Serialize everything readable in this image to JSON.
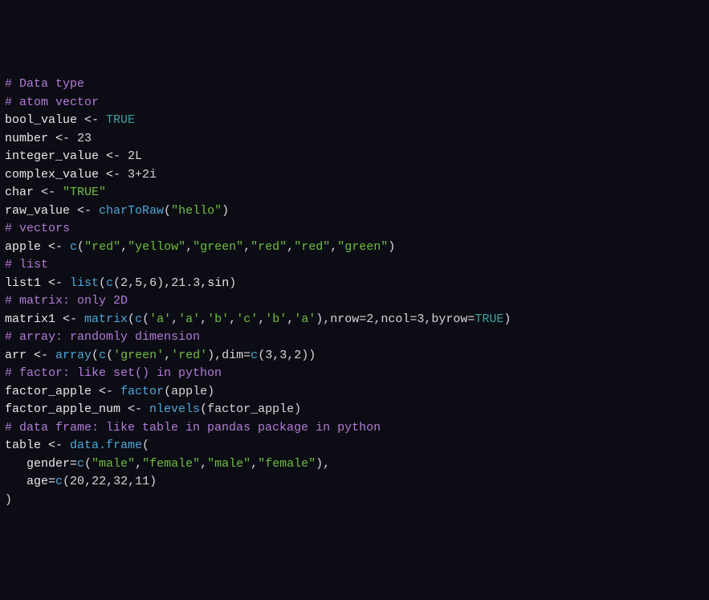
{
  "code": {
    "lines": [
      {
        "spans": [
          {
            "cls": "tok-comment",
            "t": "# Data type"
          }
        ]
      },
      {
        "spans": [
          {
            "cls": "tok-comment",
            "t": "# atom vector"
          }
        ]
      },
      {
        "spans": [
          {
            "cls": "tok-ident",
            "t": "bool_value "
          },
          {
            "cls": "tok-assign",
            "t": "<- "
          },
          {
            "cls": "tok-bool",
            "t": "TRUE"
          }
        ]
      },
      {
        "spans": [
          {
            "cls": "tok-ident",
            "t": "number "
          },
          {
            "cls": "tok-assign",
            "t": "<- "
          },
          {
            "cls": "tok-num",
            "t": "23"
          }
        ]
      },
      {
        "spans": [
          {
            "cls": "tok-ident",
            "t": "integer_value "
          },
          {
            "cls": "tok-assign",
            "t": "<- "
          },
          {
            "cls": "tok-num",
            "t": "2L"
          }
        ]
      },
      {
        "spans": [
          {
            "cls": "tok-ident",
            "t": "complex_value "
          },
          {
            "cls": "tok-assign",
            "t": "<- "
          },
          {
            "cls": "tok-num",
            "t": "3+2i"
          }
        ]
      },
      {
        "spans": [
          {
            "cls": "tok-ident",
            "t": "char "
          },
          {
            "cls": "tok-assign",
            "t": "<- "
          },
          {
            "cls": "tok-str",
            "t": "\"TRUE\""
          }
        ]
      },
      {
        "spans": [
          {
            "cls": "tok-ident",
            "t": "raw_value "
          },
          {
            "cls": "tok-assign",
            "t": "<- "
          },
          {
            "cls": "tok-func",
            "t": "charToRaw"
          },
          {
            "cls": "tok-punc",
            "t": "("
          },
          {
            "cls": "tok-str",
            "t": "\"hello\""
          },
          {
            "cls": "tok-punc",
            "t": ")"
          }
        ]
      },
      {
        "spans": [
          {
            "cls": "tok-comment",
            "t": "# vectors"
          }
        ]
      },
      {
        "spans": [
          {
            "cls": "tok-ident",
            "t": "apple "
          },
          {
            "cls": "tok-assign",
            "t": "<- "
          },
          {
            "cls": "tok-func",
            "t": "c"
          },
          {
            "cls": "tok-punc",
            "t": "("
          },
          {
            "cls": "tok-str",
            "t": "\"red\""
          },
          {
            "cls": "tok-punc",
            "t": ","
          },
          {
            "cls": "tok-str",
            "t": "\"yellow\""
          },
          {
            "cls": "tok-punc",
            "t": ","
          },
          {
            "cls": "tok-str",
            "t": "\"green\""
          },
          {
            "cls": "tok-punc",
            "t": ","
          },
          {
            "cls": "tok-str",
            "t": "\"red\""
          },
          {
            "cls": "tok-punc",
            "t": ","
          },
          {
            "cls": "tok-str",
            "t": "\"red\""
          },
          {
            "cls": "tok-punc",
            "t": ","
          },
          {
            "cls": "tok-str",
            "t": "\"green\""
          },
          {
            "cls": "tok-punc",
            "t": ")"
          }
        ]
      },
      {
        "spans": [
          {
            "cls": "tok-comment",
            "t": "# list"
          }
        ]
      },
      {
        "spans": [
          {
            "cls": "tok-ident",
            "t": "list1 "
          },
          {
            "cls": "tok-assign",
            "t": "<- "
          },
          {
            "cls": "tok-func",
            "t": "list"
          },
          {
            "cls": "tok-punc",
            "t": "("
          },
          {
            "cls": "tok-func",
            "t": "c"
          },
          {
            "cls": "tok-punc",
            "t": "("
          },
          {
            "cls": "tok-num",
            "t": "2"
          },
          {
            "cls": "tok-punc",
            "t": ","
          },
          {
            "cls": "tok-num",
            "t": "5"
          },
          {
            "cls": "tok-punc",
            "t": ","
          },
          {
            "cls": "tok-num",
            "t": "6"
          },
          {
            "cls": "tok-punc",
            "t": "),"
          },
          {
            "cls": "tok-num",
            "t": "21.3"
          },
          {
            "cls": "tok-punc",
            "t": ","
          },
          {
            "cls": "tok-ident",
            "t": "sin"
          },
          {
            "cls": "tok-punc",
            "t": ")"
          }
        ]
      },
      {
        "spans": [
          {
            "cls": "tok-comment",
            "t": "# matrix: only 2D"
          }
        ]
      },
      {
        "spans": [
          {
            "cls": "tok-ident",
            "t": "matrix1 "
          },
          {
            "cls": "tok-assign",
            "t": "<- "
          },
          {
            "cls": "tok-func",
            "t": "matrix"
          },
          {
            "cls": "tok-punc",
            "t": "("
          },
          {
            "cls": "tok-func",
            "t": "c"
          },
          {
            "cls": "tok-punc",
            "t": "("
          },
          {
            "cls": "tok-str",
            "t": "'a'"
          },
          {
            "cls": "tok-punc",
            "t": ","
          },
          {
            "cls": "tok-str",
            "t": "'a'"
          },
          {
            "cls": "tok-punc",
            "t": ","
          },
          {
            "cls": "tok-str",
            "t": "'b'"
          },
          {
            "cls": "tok-punc",
            "t": ","
          },
          {
            "cls": "tok-str",
            "t": "'c'"
          },
          {
            "cls": "tok-punc",
            "t": ","
          },
          {
            "cls": "tok-str",
            "t": "'b'"
          },
          {
            "cls": "tok-punc",
            "t": ","
          },
          {
            "cls": "tok-str",
            "t": "'a'"
          },
          {
            "cls": "tok-punc",
            "t": "),"
          },
          {
            "cls": "tok-kwarg",
            "t": "nrow="
          },
          {
            "cls": "tok-num",
            "t": "2"
          },
          {
            "cls": "tok-punc",
            "t": ","
          },
          {
            "cls": "tok-kwarg",
            "t": "ncol="
          },
          {
            "cls": "tok-num",
            "t": "3"
          },
          {
            "cls": "tok-punc",
            "t": ","
          },
          {
            "cls": "tok-kwarg",
            "t": "byrow="
          },
          {
            "cls": "tok-bool",
            "t": "TRUE"
          },
          {
            "cls": "tok-punc",
            "t": ")"
          }
        ]
      },
      {
        "spans": [
          {
            "cls": "tok-comment",
            "t": "# array: randomly dimension"
          }
        ]
      },
      {
        "spans": [
          {
            "cls": "tok-ident",
            "t": "arr "
          },
          {
            "cls": "tok-assign",
            "t": "<- "
          },
          {
            "cls": "tok-func",
            "t": "array"
          },
          {
            "cls": "tok-punc",
            "t": "("
          },
          {
            "cls": "tok-func",
            "t": "c"
          },
          {
            "cls": "tok-punc",
            "t": "("
          },
          {
            "cls": "tok-str",
            "t": "'green'"
          },
          {
            "cls": "tok-punc",
            "t": ","
          },
          {
            "cls": "tok-str",
            "t": "'red'"
          },
          {
            "cls": "tok-punc",
            "t": "),"
          },
          {
            "cls": "tok-kwarg",
            "t": "dim="
          },
          {
            "cls": "tok-func",
            "t": "c"
          },
          {
            "cls": "tok-punc",
            "t": "("
          },
          {
            "cls": "tok-num",
            "t": "3"
          },
          {
            "cls": "tok-punc",
            "t": ","
          },
          {
            "cls": "tok-num",
            "t": "3"
          },
          {
            "cls": "tok-punc",
            "t": ","
          },
          {
            "cls": "tok-num",
            "t": "2"
          },
          {
            "cls": "tok-punc",
            "t": "))"
          }
        ]
      },
      {
        "spans": [
          {
            "cls": "tok-comment",
            "t": "# factor: like set() in python"
          }
        ]
      },
      {
        "spans": [
          {
            "cls": "tok-ident",
            "t": "factor_apple "
          },
          {
            "cls": "tok-assign",
            "t": "<- "
          },
          {
            "cls": "tok-func",
            "t": "factor"
          },
          {
            "cls": "tok-punc",
            "t": "(apple)"
          }
        ]
      },
      {
        "spans": [
          {
            "cls": "tok-ident",
            "t": "factor_apple_num "
          },
          {
            "cls": "tok-assign",
            "t": "<- "
          },
          {
            "cls": "tok-func",
            "t": "nlevels"
          },
          {
            "cls": "tok-punc",
            "t": "(factor_apple)"
          }
        ]
      },
      {
        "spans": [
          {
            "cls": "tok-comment",
            "t": "# data frame: like table in pandas package in python"
          }
        ]
      },
      {
        "spans": [
          {
            "cls": "tok-ident",
            "t": "table "
          },
          {
            "cls": "tok-assign",
            "t": "<- "
          },
          {
            "cls": "tok-func",
            "t": "data.frame"
          },
          {
            "cls": "tok-punc",
            "t": "("
          }
        ]
      },
      {
        "spans": [
          {
            "cls": "tok-ident",
            "t": "   gender="
          },
          {
            "cls": "tok-func",
            "t": "c"
          },
          {
            "cls": "tok-punc",
            "t": "("
          },
          {
            "cls": "tok-str",
            "t": "\"male\""
          },
          {
            "cls": "tok-punc",
            "t": ","
          },
          {
            "cls": "tok-str",
            "t": "\"female\""
          },
          {
            "cls": "tok-punc",
            "t": ","
          },
          {
            "cls": "tok-str",
            "t": "\"male\""
          },
          {
            "cls": "tok-punc",
            "t": ","
          },
          {
            "cls": "tok-str",
            "t": "\"female\""
          },
          {
            "cls": "tok-punc",
            "t": "),"
          }
        ]
      },
      {
        "spans": [
          {
            "cls": "tok-ident",
            "t": "   age="
          },
          {
            "cls": "tok-func",
            "t": "c"
          },
          {
            "cls": "tok-punc",
            "t": "("
          },
          {
            "cls": "tok-num",
            "t": "20"
          },
          {
            "cls": "tok-punc",
            "t": ","
          },
          {
            "cls": "tok-num",
            "t": "22"
          },
          {
            "cls": "tok-punc",
            "t": ","
          },
          {
            "cls": "tok-num",
            "t": "32"
          },
          {
            "cls": "tok-punc",
            "t": ","
          },
          {
            "cls": "tok-num",
            "t": "11"
          },
          {
            "cls": "tok-punc",
            "t": ")"
          }
        ]
      },
      {
        "spans": [
          {
            "cls": "tok-punc",
            "t": ")"
          }
        ]
      }
    ]
  }
}
